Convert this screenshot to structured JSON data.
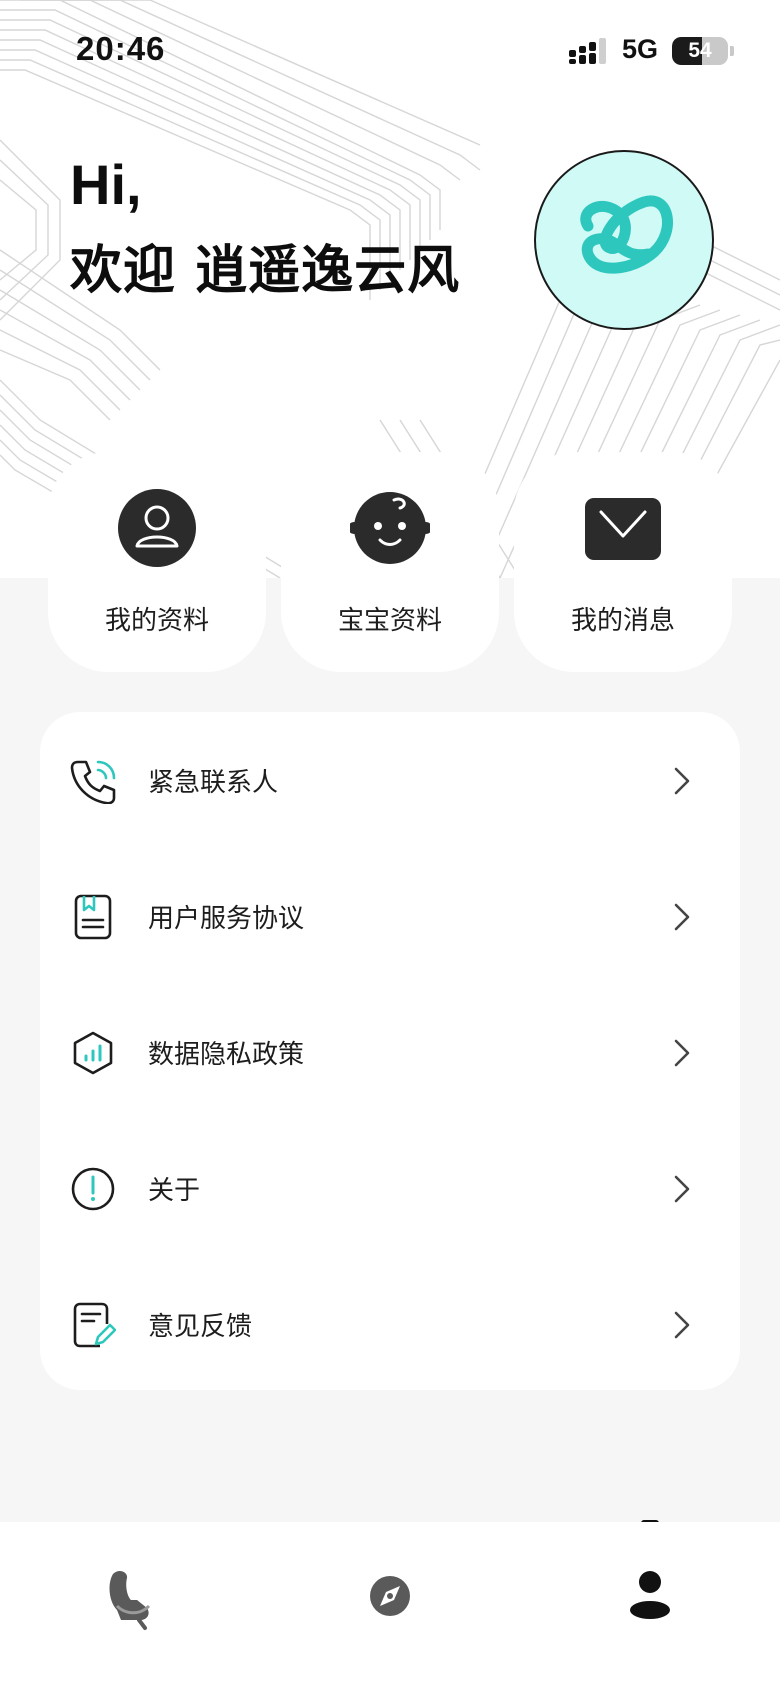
{
  "status_bar": {
    "time": "20:46",
    "network": "5G",
    "battery_level": "54",
    "battery_fraction": 0.54
  },
  "header": {
    "greeting": "Hi,",
    "welcome": "欢迎 逍遥逸云风",
    "avatar_icon": "swirl-logo-icon",
    "avatar_bg": "#cffaf6",
    "accent": "#2ec7bd"
  },
  "quick_actions": [
    {
      "label": "我的资料",
      "icon": "person-icon"
    },
    {
      "label": "宝宝资料",
      "icon": "baby-face-icon"
    },
    {
      "label": "我的消息",
      "icon": "envelope-icon"
    }
  ],
  "menu": [
    {
      "label": "紧急联系人",
      "icon": "phone-call-icon"
    },
    {
      "label": "用户服务协议",
      "icon": "document-bookmark-icon"
    },
    {
      "label": "数据隐私政策",
      "icon": "shield-chart-icon"
    },
    {
      "label": "关于",
      "icon": "info-exclamation-icon"
    },
    {
      "label": "意见反馈",
      "icon": "feedback-edit-icon"
    }
  ],
  "bottom_nav": [
    {
      "name": "car-seat-tab",
      "icon": "car-seat-icon",
      "active": false
    },
    {
      "name": "discover-tab",
      "icon": "compass-disc-icon",
      "active": false
    },
    {
      "name": "profile-tab",
      "icon": "person-icon",
      "active": true
    }
  ]
}
